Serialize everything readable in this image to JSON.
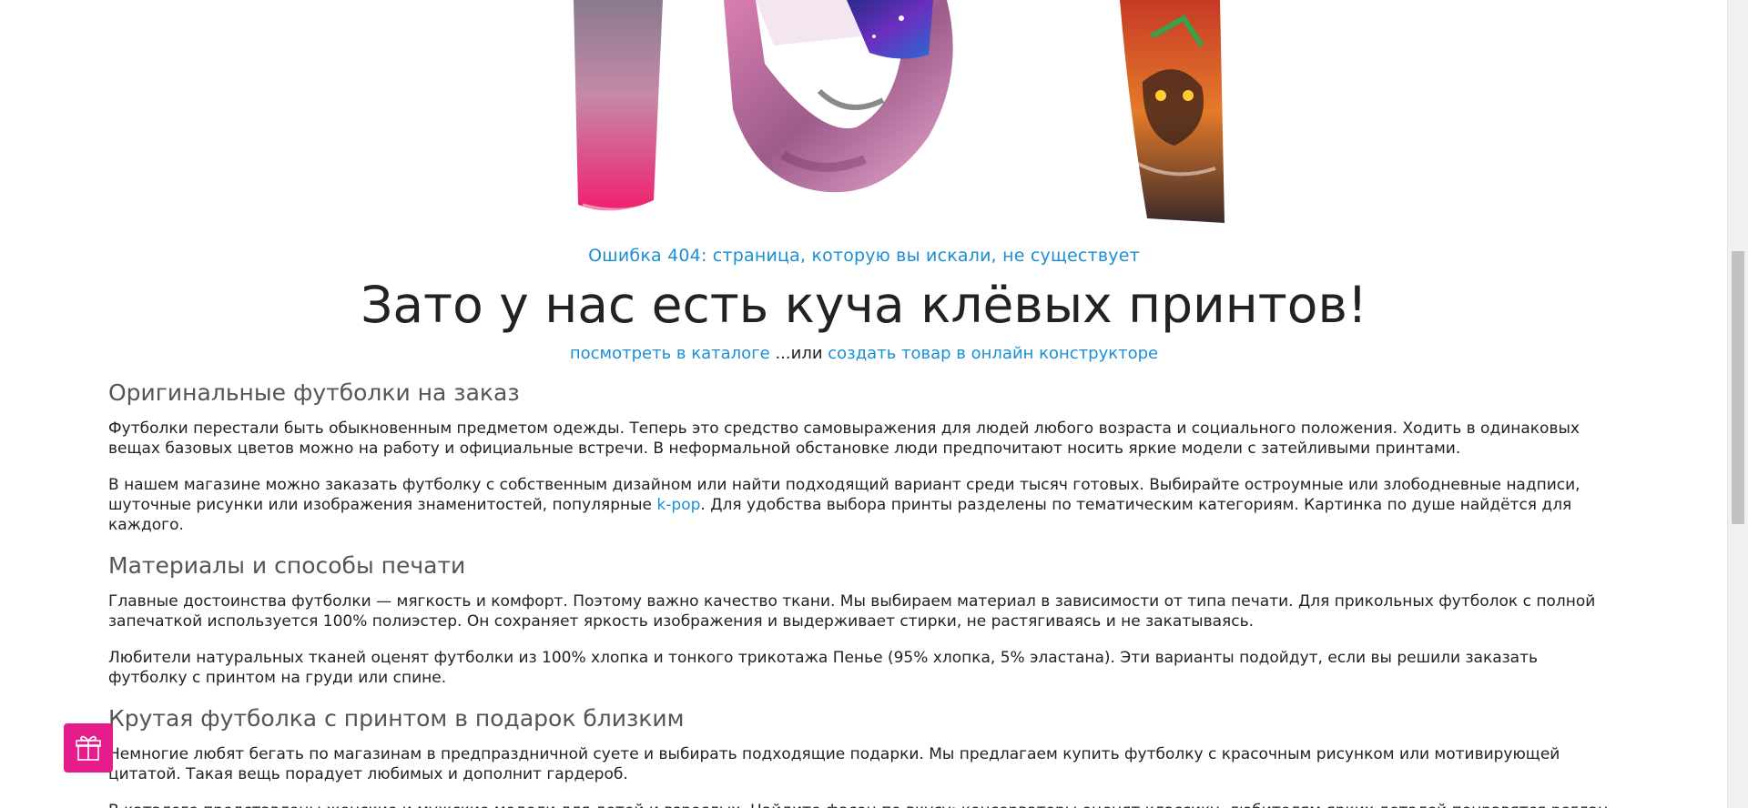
{
  "hero": {
    "image_alt": "404"
  },
  "error": {
    "message": "Ошибка 404: страница, которую вы искали, не существует"
  },
  "headline": "Зато у нас есть куча клёвых принтов!",
  "links": {
    "catalog": "посмотреть в каталоге",
    "separator": " ...или ",
    "constructor": "создать товар в онлайн конструкторе"
  },
  "sections": [
    {
      "title": "Оригинальные футболки на заказ",
      "paragraphs": [
        "Футболки перестали быть обыкновенным предметом одежды. Теперь это средство самовыражения для людей любого возраста и социального положения. Ходить в одинаковых вещах базовых цветов можно на работу и официальные встречи. В неформальной обстановке люди предпочитают носить яркие модели с затейливыми принтами.",
        {
          "before": "В нашем магазине можно заказать футболку с собственным дизайном или найти подходящий вариант среди тысяч готовых. Выбирайте остроумные или злободневные надписи, шуточные рисунки или изображения знаменитостей, популярные ",
          "link": "k-pop",
          "after": ". Для удобства выбора принты разделены по тематическим категориям. Картинка по душе найдётся для каждого."
        }
      ]
    },
    {
      "title": "Материалы и способы печати",
      "paragraphs": [
        "Главные достоинства футболки — мягкость и комфорт. Поэтому важно качество ткани. Мы выбираем материал в зависимости от типа печати. Для прикольных футболок с полной запечаткой используется 100% полиэстер. Он сохраняет яркость изображения и выдерживает стирки, не растягиваясь и не закатываясь.",
        "Любители натуральных тканей оценят футболки из 100% хлопка и тонкого трикотажа Пенье (95% хлопка, 5% эластана). Эти варианты подойдут, если вы решили заказать футболку с принтом на груди или спине."
      ]
    },
    {
      "title": "Крутая футболка с принтом в подарок близким",
      "paragraphs": [
        "Немногие любят бегать по магазинам в предпраздничной суете и выбирать подходящие подарки. Мы предлагаем купить футболку с красочным рисунком или мотивирующей цитатой. Такая вещь порадует любимых и дополнит гардероб.",
        "В каталоге представлены женские и мужские модели для детей и взрослых. Найдите фасон по вкусу: консерваторы оценят классику, любителям ярких деталей понравятся реглан"
      ]
    }
  ],
  "gift_button": {
    "icon": "gift-icon"
  },
  "colors": {
    "link": "#1a8fd6",
    "accent": "#e61c8a",
    "text": "#222222",
    "heading": "#555555"
  }
}
